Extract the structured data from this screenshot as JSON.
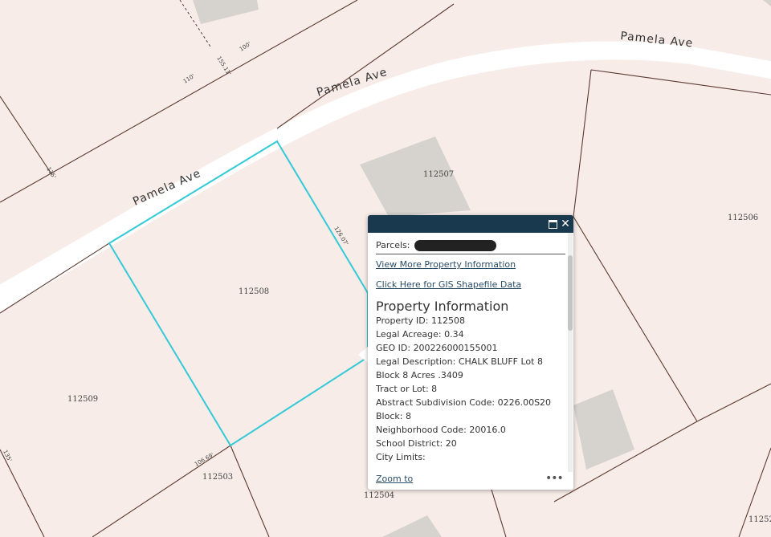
{
  "map": {
    "street_labels": [
      "Pamela Ave",
      "Pamela Ave",
      "Pamela Ave"
    ],
    "parcel_ids": [
      "112507",
      "112506",
      "112508",
      "112509",
      "112503",
      "112504",
      "11252"
    ],
    "dimension_labels": [
      "100'",
      "110'",
      "155.11'",
      "135'",
      "126.07'",
      "106.69'",
      "135'"
    ],
    "colors": {
      "background": "#f7ece8",
      "road": "#ffffff",
      "parcel_line": "#5b3a30",
      "selected_parcel": "#33c9d6",
      "building": "#d6d3ce"
    }
  },
  "popup": {
    "parcels_label": "Parcels:",
    "link_more_info": "View More Property Information",
    "link_gis": "Click Here for GIS Shapefile Data",
    "section_heading": "Property Information",
    "attributes": [
      {
        "key": "Property ID:",
        "value": "112508"
      },
      {
        "key": "Legal Acreage:",
        "value": "0.34"
      },
      {
        "key": "GEO ID:",
        "value": "200226000155001"
      },
      {
        "key": "Legal Description:",
        "value": "CHALK BLUFF Lot 8 Block 8 Acres .3409"
      },
      {
        "key": "Tract or Lot:",
        "value": "8"
      },
      {
        "key": "Abstract Subdivision Code:",
        "value": "0226.00S20"
      },
      {
        "key": "Block:",
        "value": "8"
      },
      {
        "key": "Neighborhood Code:",
        "value": "20016.0"
      },
      {
        "key": "School District:",
        "value": "20"
      },
      {
        "key": "City Limits:",
        "value": ""
      }
    ],
    "zoom_label": "Zoom to",
    "more_label": "•••",
    "header_color": "#19394f",
    "link_color": "#2b4d66"
  }
}
